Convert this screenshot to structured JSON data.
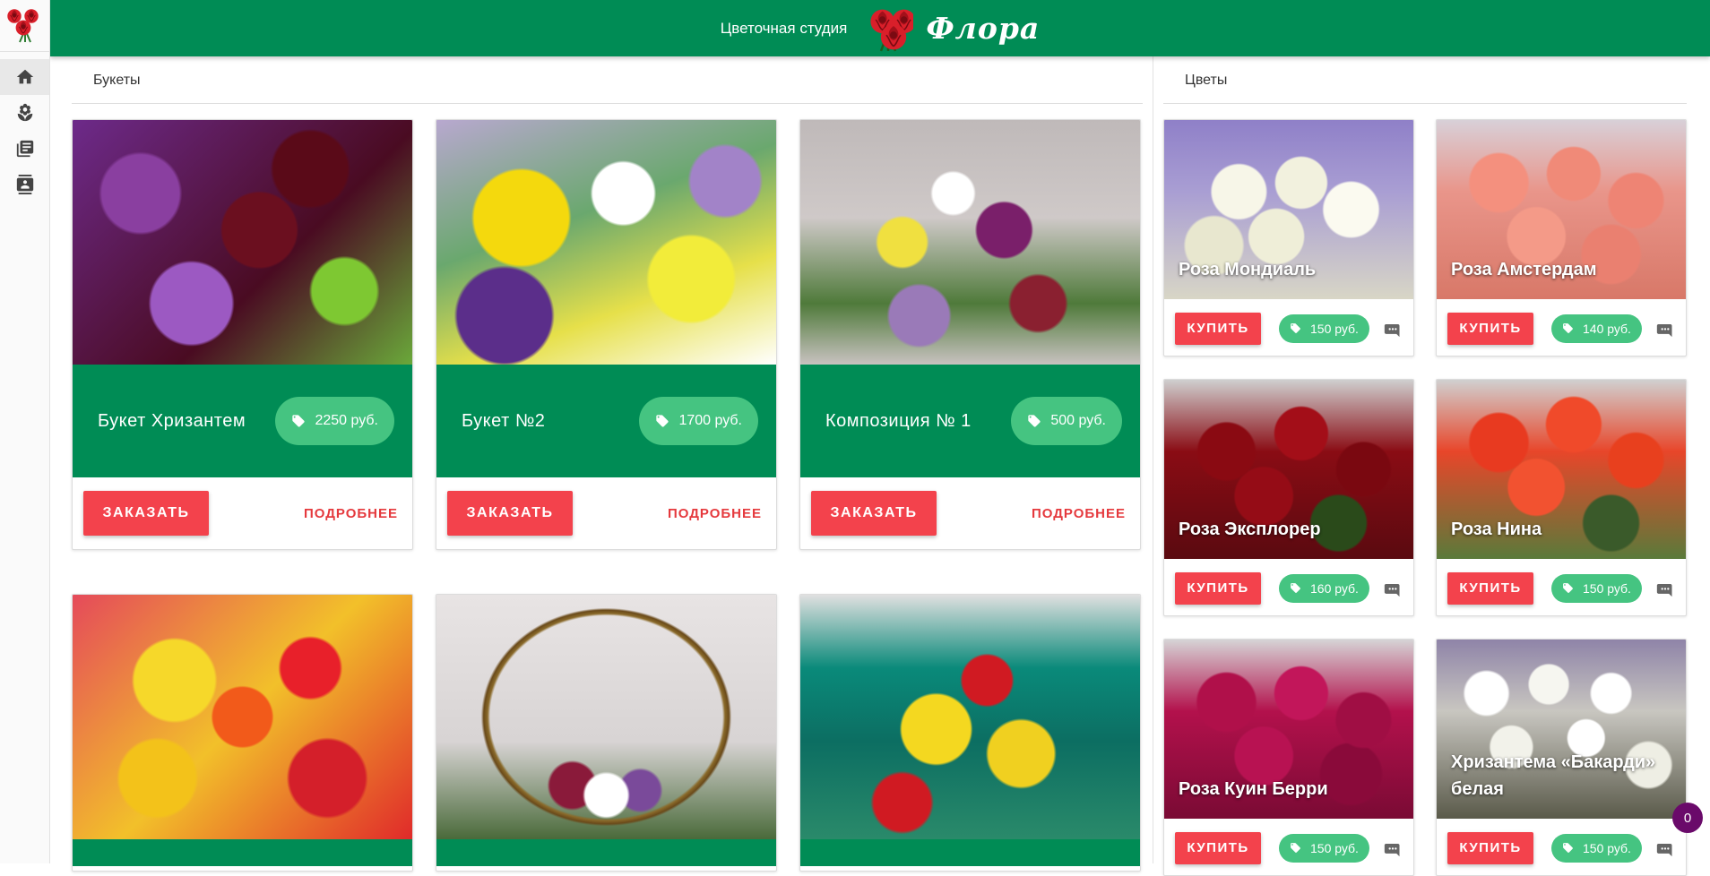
{
  "header": {
    "subtitle": "Цветочная студия",
    "title": "Флора",
    "color": "#008c55"
  },
  "sidebar": {
    "items": [
      {
        "icon": "home-icon",
        "active": true
      },
      {
        "icon": "flower-icon",
        "active": false
      },
      {
        "icon": "catalog-icon",
        "active": false
      },
      {
        "icon": "contacts-icon",
        "active": false
      }
    ]
  },
  "bouquets": {
    "title": "Букеты",
    "order_label": "ЗАКАЗАТЬ",
    "more_label": "ПОДРОБНЕЕ",
    "items": [
      {
        "name": "Букет Хризантем",
        "price": "2250 руб."
      },
      {
        "name": "Букет №2",
        "price": "1700 руб."
      },
      {
        "name": "Композиция № 1",
        "price": "500 руб."
      },
      {
        "name": "",
        "price": ""
      },
      {
        "name": "",
        "price": ""
      },
      {
        "name": "",
        "price": ""
      }
    ]
  },
  "flowers": {
    "title": "Цветы",
    "buy_label": "КУПИТЬ",
    "items": [
      {
        "name": "Роза Мондиаль",
        "price": "150 руб."
      },
      {
        "name": "Роза Амстердам",
        "price": "140 руб."
      },
      {
        "name": "Роза Эксплорер",
        "price": "160 руб."
      },
      {
        "name": "Роза Нина",
        "price": "150 руб."
      },
      {
        "name": "Роза Куин Берри",
        "price": "150 руб."
      },
      {
        "name": "Хризантема «Бакарди» белая",
        "price": "150 руб."
      }
    ]
  },
  "cart": {
    "count": "0"
  },
  "colors": {
    "accent_green": "#008c55",
    "price_green": "#45c481",
    "button_red": "#f3424c",
    "cart_badge": "#6a0a6a"
  }
}
